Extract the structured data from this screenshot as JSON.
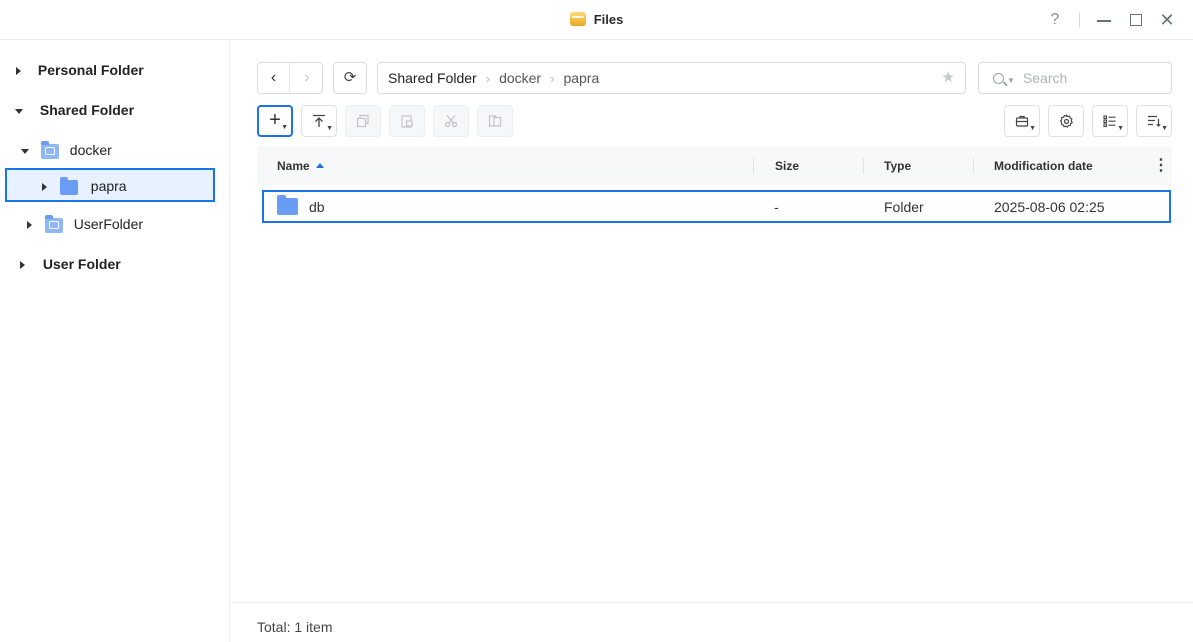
{
  "window": {
    "title": "Files",
    "help_glyph": "?",
    "close_glyph": "✕"
  },
  "sidebar": {
    "items": [
      {
        "label": "Personal Folder",
        "expanded": false
      },
      {
        "label": "Shared Folder",
        "expanded": true
      },
      {
        "label": "docker",
        "expanded": true,
        "icon": "shared-folder-icon"
      },
      {
        "label": "papra",
        "expanded": false,
        "selected": true,
        "icon": "folder-icon"
      },
      {
        "label": "UserFolder",
        "expanded": false,
        "icon": "shared-folder-icon"
      },
      {
        "label": "User Folder",
        "expanded": false
      }
    ]
  },
  "toolbar": {
    "back_glyph": "‹",
    "forward_glyph": "›",
    "refresh_glyph": "⟳",
    "create_glyph": "+",
    "star_glyph": "★"
  },
  "path": {
    "crumbs": [
      "Shared Folder",
      "docker",
      "papra"
    ],
    "separator": "›"
  },
  "search": {
    "placeholder": "Search"
  },
  "table": {
    "columns": [
      "Name",
      "Size",
      "Type",
      "Modification date"
    ],
    "sort": {
      "column": "Name",
      "direction": "ascending"
    },
    "more_glyph": "⋮",
    "rows": [
      {
        "name": "db",
        "size": "-",
        "type": "Folder",
        "modified": "2025-08-06 02:25",
        "selected": true
      }
    ]
  },
  "status": {
    "text": "Total: 1 item"
  },
  "colors": {
    "accent": "#1a73e8",
    "folder": "#6b9cf5",
    "selection_bg": "#e8f1ff"
  }
}
